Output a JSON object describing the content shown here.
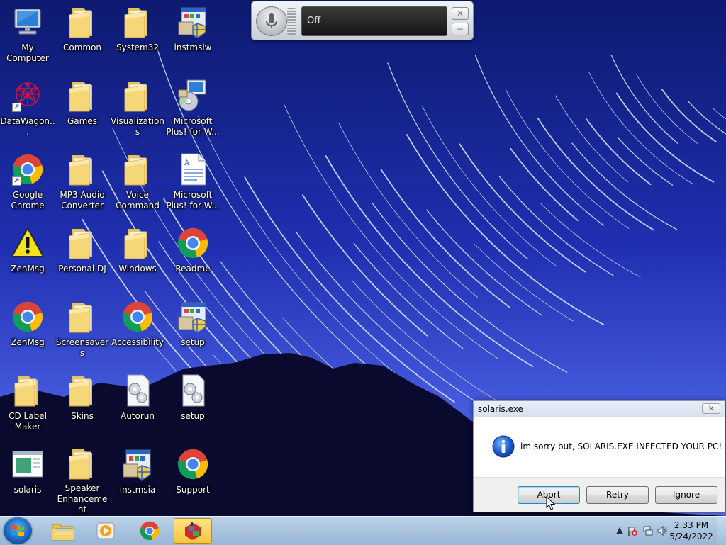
{
  "desktop": {
    "icons": [
      {
        "label": "My Computer",
        "icon": "computer-icon"
      },
      {
        "label": "Common",
        "icon": "folder-icon"
      },
      {
        "label": "System32",
        "icon": "folder-icon"
      },
      {
        "label": "instmsiw",
        "icon": "installer-icon"
      },
      {
        "label": "DataWagon...",
        "icon": "datawagon-icon"
      },
      {
        "label": "Games",
        "icon": "folder-icon"
      },
      {
        "label": "Visualizations",
        "icon": "folder-icon"
      },
      {
        "label": "Microsoft Plus! for W...",
        "icon": "setup-cd-icon"
      },
      {
        "label": "Google Chrome",
        "icon": "chrome-icon"
      },
      {
        "label": "MP3 Audio Converter",
        "icon": "folder-icon"
      },
      {
        "label": "Voice Command",
        "icon": "folder-icon"
      },
      {
        "label": "Microsoft Plus! for W...",
        "icon": "document-icon"
      },
      {
        "label": "ZenMsg",
        "icon": "warning-icon"
      },
      {
        "label": "Personal DJ",
        "icon": "folder-icon"
      },
      {
        "label": "Windows",
        "icon": "folder-icon"
      },
      {
        "label": "Readme",
        "icon": "chrome-icon"
      },
      {
        "label": "ZenMsg",
        "icon": "chrome-icon"
      },
      {
        "label": "Screensavers",
        "icon": "folder-icon"
      },
      {
        "label": "Accessibility",
        "icon": "chrome-icon"
      },
      {
        "label": "setup",
        "icon": "installer-icon"
      },
      {
        "label": "CD Label Maker",
        "icon": "folder-icon"
      },
      {
        "label": "Skins",
        "icon": "folder-icon"
      },
      {
        "label": "Autorun",
        "icon": "gear-file-icon"
      },
      {
        "label": "setup",
        "icon": "gear-file-icon"
      },
      {
        "label": "solaris",
        "icon": "app-window-icon"
      },
      {
        "label": "Speaker Enhancement",
        "icon": "folder-icon"
      },
      {
        "label": "instmsia",
        "icon": "installer-icon"
      },
      {
        "label": "Support",
        "icon": "chrome-icon"
      }
    ]
  },
  "speech_bar": {
    "status": "Off"
  },
  "dialog": {
    "title": "solaris.exe",
    "message": "im sorry but, SOLARIS.EXE INFECTED YOUR PC!",
    "buttons": {
      "abort": "Abort",
      "retry": "Retry",
      "ignore": "Ignore"
    }
  },
  "taskbar": {
    "apps": [
      {
        "icon": "explorer-icon",
        "active": false
      },
      {
        "icon": "media-player-icon",
        "active": false
      },
      {
        "icon": "chrome-icon",
        "active": false
      },
      {
        "icon": "solaris-app-icon",
        "active": true
      }
    ],
    "clock": {
      "time": "2:33 PM",
      "date": "5/24/2022"
    }
  },
  "colors": {
    "sky": "#1b2a9c",
    "accent_blue": "#1760b6",
    "taskbar": "#a9c3de"
  }
}
